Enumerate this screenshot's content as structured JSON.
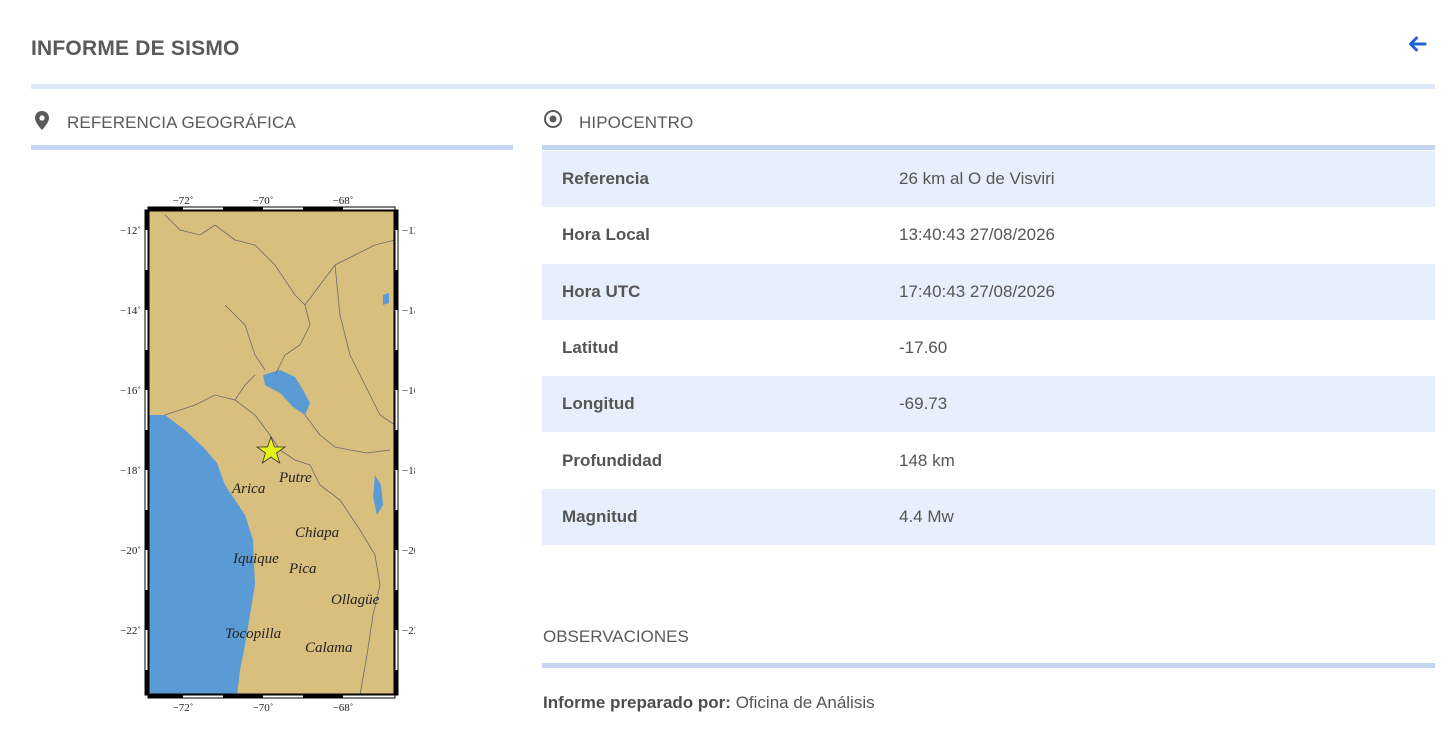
{
  "header": {
    "title": "INFORME DE SISMO"
  },
  "colors": {
    "accent": "#1e63d6",
    "row_alt": "#e7effc",
    "divider": "#c5d6f3",
    "sea": "#5b9bd5",
    "land": "#d8bf7e",
    "epicenter": "#e6f21a"
  },
  "geo": {
    "title": "REFERENCIA GEOGRÁFICA",
    "map": {
      "lon_ticks": [
        "−72˚",
        "−70˚",
        "−68˚"
      ],
      "lat_ticks": [
        "−12˚",
        "−14˚",
        "−16˚",
        "−18˚",
        "−20˚",
        "−22˚"
      ],
      "places": [
        "Arica",
        "Putre",
        "Chiapa",
        "Iquique",
        "Pica",
        "Ollagüe",
        "Tocopilla",
        "Calama"
      ]
    }
  },
  "hipocentro": {
    "title": "HIPOCENTRO",
    "rows": [
      {
        "key": "Referencia",
        "value": "26 km al O de Visviri"
      },
      {
        "key": "Hora Local",
        "value": "13:40:43 27/08/2026"
      },
      {
        "key": "Hora UTC",
        "value": "17:40:43 27/08/2026"
      },
      {
        "key": "Latitud",
        "value": "-17.60"
      },
      {
        "key": "Longitud",
        "value": "-69.73"
      },
      {
        "key": "Profundidad",
        "value": "148 km"
      },
      {
        "key": "Magnitud",
        "value": "4.4 Mw"
      }
    ]
  },
  "observaciones": {
    "title": "OBSERVACIONES",
    "prepared_label": "Informe preparado por:",
    "prepared_value": "Oficina de Análisis"
  }
}
